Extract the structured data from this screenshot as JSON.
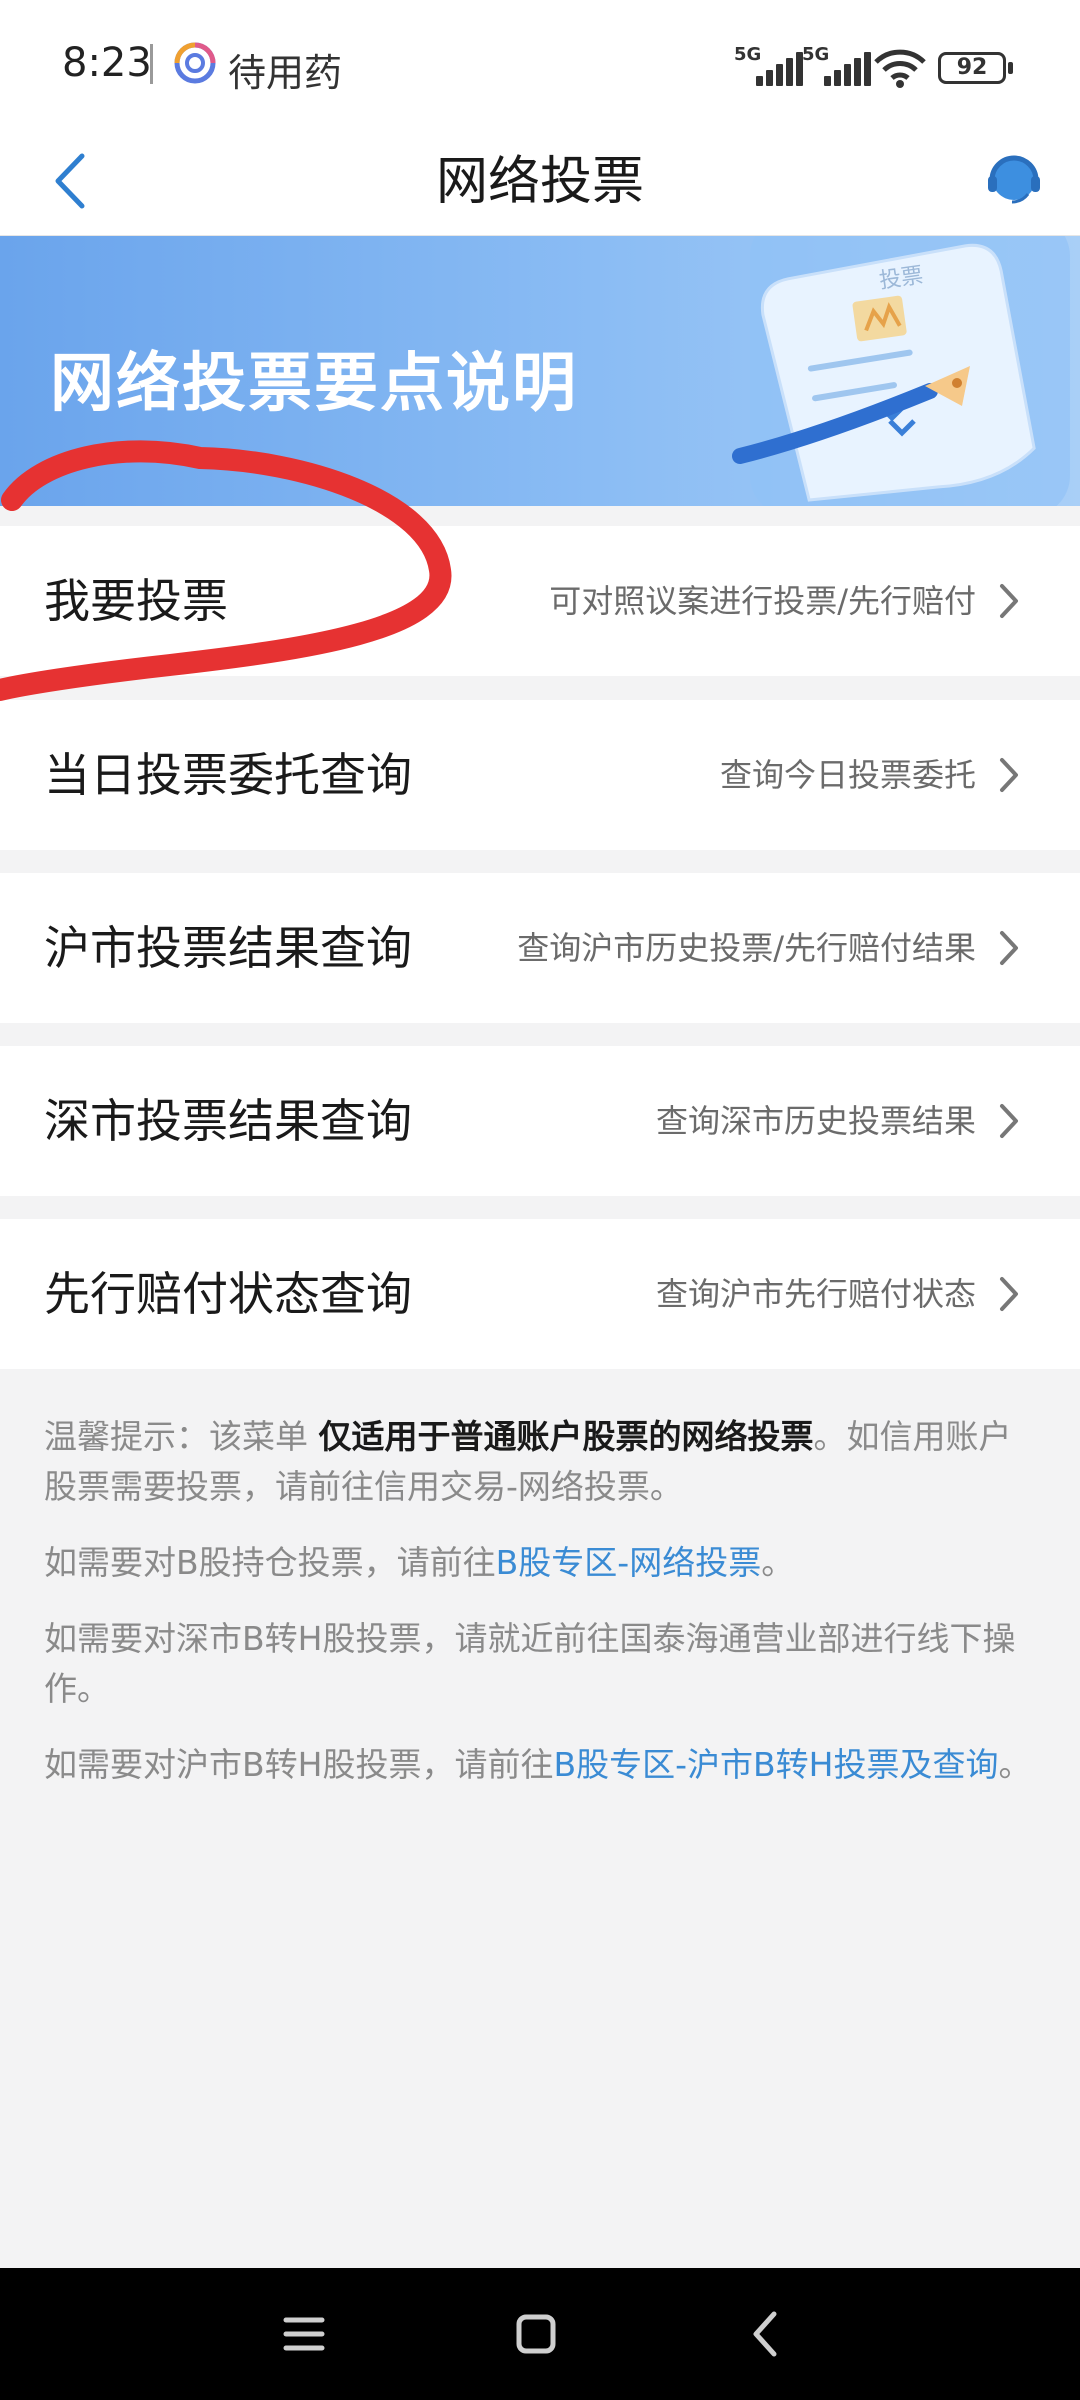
{
  "status_bar": {
    "time": "8:23",
    "app_name": "待用药",
    "signal_1": "5G",
    "signal_2": "5G",
    "battery": "92"
  },
  "nav": {
    "title": "网络投票",
    "back_icon": "chevron-left-icon",
    "service_icon": "customer-service-icon"
  },
  "banner": {
    "title": "网络投票要点说明",
    "art_label": "投票"
  },
  "menu": [
    {
      "title": "我要投票",
      "desc": "可对照议案进行投票/先行赔付"
    },
    {
      "title": "当日投票委托查询",
      "desc": "查询今日投票委托"
    },
    {
      "title": "沪市投票结果查询",
      "desc": "查询沪市历史投票/先行赔付结果"
    },
    {
      "title": "深市投票结果查询",
      "desc": "查询深市历史投票结果"
    },
    {
      "title": "先行赔付状态查询",
      "desc": "查询沪市先行赔付状态"
    }
  ],
  "notes": {
    "n1_prefix": "温馨提示：该菜单 ",
    "n1_bold": "仅适用于普通账户股票的网络投票",
    "n1_suffix": "。如信用账户股票需要投票，请前往信用交易-网络投票。",
    "n2_prefix": "如需要对B股持仓投票，请前往",
    "n2_link": "B股专区-网络投票",
    "n2_suffix": "。",
    "n3": "如需要对深市B转H股投票，请就近前往国泰海通营业部进行线下操作。",
    "n4_prefix": "如需要对沪市B转H股投票，请前往",
    "n4_link": "B股专区-沪市B转H投票及查询",
    "n4_suffix": "。"
  },
  "colors": {
    "accent": "#3a8bd4",
    "annotation": "#e63232",
    "banner_start": "#6aa4ec"
  }
}
